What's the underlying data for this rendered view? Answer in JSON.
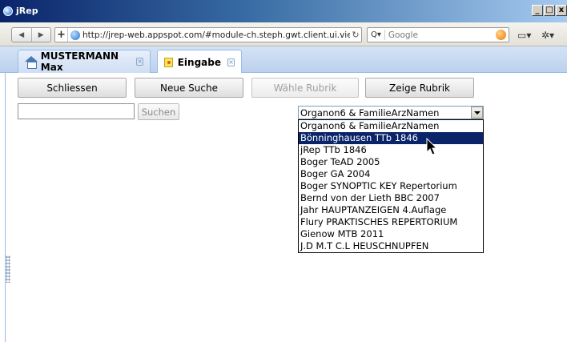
{
  "window": {
    "title": "jRep",
    "controls": [
      "_",
      "□",
      "x"
    ]
  },
  "browser": {
    "url": "http://jrep-web.appspot.com/#module-ch.steph.gwt.client.ui.vie",
    "search_engine": "Google",
    "back_icon": "back-arrow-icon",
    "forward_icon": "forward-arrow-icon"
  },
  "tabs": [
    {
      "label": "MUSTERMANN Max",
      "icon": "home-icon"
    },
    {
      "label": "Eingabe",
      "icon": "form-icon"
    }
  ],
  "toolbar": {
    "close_label": "Schliessen",
    "new_search_label": "Neue Suche",
    "choose_rubric_label": "Wähle Rubrik",
    "show_rubric_label": "Zeige Rubrik"
  },
  "search": {
    "value": "",
    "button_label": "Suchen"
  },
  "repertory_select": {
    "selected": "Organon6 & FamilieArzNamen",
    "highlighted_index": 1,
    "options": [
      "Organon6 & FamilieArzNamen",
      "Bönninghausen TTb 1846",
      "jRep TTb 1846",
      "Boger TeAD 2005",
      "Boger GA 2004",
      "Boger SYNOPTIC KEY Repertorium",
      "Bernd von der Lieth BBC 2007",
      "Jahr HAUPTANZEIGEN 4.Auflage",
      "Flury PRAKTISCHES REPERTORIUM",
      "Gienow MTB 2011",
      "J.D M.T C.L HEUSCHNUPFEN"
    ]
  },
  "colors": {
    "accent": "#15428b",
    "selection": "#0a246a"
  }
}
